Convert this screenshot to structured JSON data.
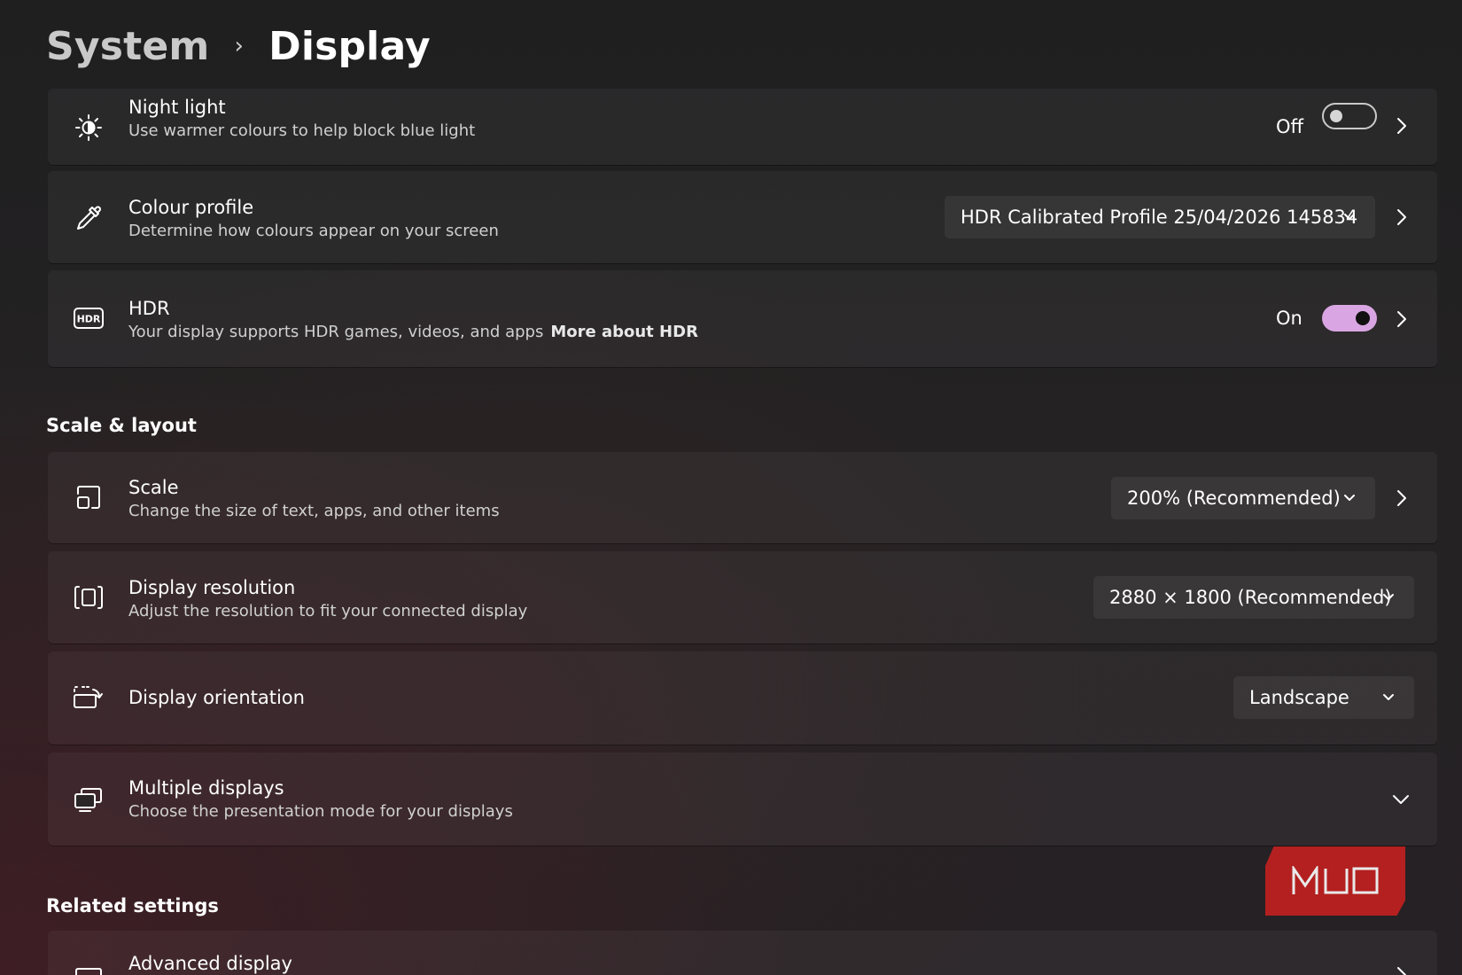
{
  "breadcrumb": {
    "parent": "System",
    "separator": "›",
    "current": "Display"
  },
  "rows": {
    "night_light": {
      "title": "Night light",
      "desc": "Use warmer colours to help block blue light",
      "state": "Off",
      "icon": "sun-icon"
    },
    "colour_profile": {
      "title": "Colour profile",
      "desc": "Determine how colours appear on your screen",
      "value": "HDR Calibrated Profile 25/04/2026 145834",
      "icon": "eyedropper-icon"
    },
    "hdr": {
      "title": "HDR",
      "desc": "Your display supports HDR games, videos, and apps",
      "link": "More about HDR",
      "state": "On",
      "icon": "hdr-icon",
      "icon_text": "HDR"
    }
  },
  "scale_layout": {
    "heading": "Scale & layout",
    "scale": {
      "title": "Scale",
      "desc": "Change the size of text, apps, and other items",
      "value": "200% (Recommended)",
      "icon": "scale-icon"
    },
    "resolution": {
      "title": "Display resolution",
      "desc": "Adjust the resolution to fit your connected display",
      "value": "2880 × 1800 (Recommended)",
      "icon": "resolution-icon"
    },
    "orientation": {
      "title": "Display orientation",
      "value": "Landscape",
      "icon": "rotate-screen-icon"
    },
    "multiple": {
      "title": "Multiple displays",
      "desc": "Choose the presentation mode for your displays",
      "icon": "multiple-displays-icon"
    }
  },
  "related": {
    "heading": "Related settings",
    "advanced": {
      "title": "Advanced display",
      "icon": "monitor-icon"
    }
  },
  "watermark": {
    "text": "MUO"
  },
  "colors": {
    "accent": "#d9a6e3",
    "watermark": "#b3201f",
    "background": "#232122"
  }
}
